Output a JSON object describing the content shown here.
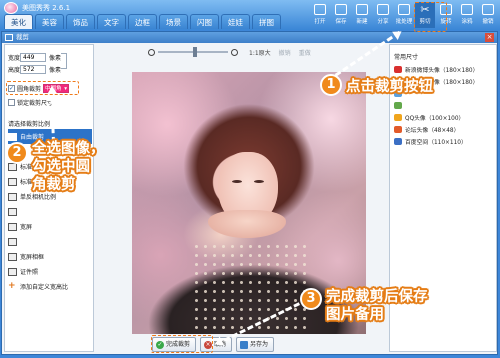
{
  "app": {
    "title": "美图秀秀 2.6.1"
  },
  "window_controls": [
    "_",
    "□",
    "×"
  ],
  "main_tabs": [
    "美化",
    "美容",
    "饰品",
    "文字",
    "边框",
    "场景",
    "闪图",
    "娃娃",
    "拼图"
  ],
  "toolbar": [
    {
      "label": "打开",
      "icon": "open-folder-icon"
    },
    {
      "label": "保存",
      "icon": "save-icon"
    },
    {
      "label": "新建",
      "icon": "new-file-icon"
    },
    {
      "label": "分享",
      "icon": "share-icon"
    },
    {
      "label": "批处理",
      "icon": "batch-icon"
    },
    {
      "label": "剪切",
      "icon": "crop-icon"
    },
    {
      "label": "旋转",
      "icon": "rotate-icon"
    },
    {
      "label": "涂鸦",
      "icon": "doodle-icon"
    },
    {
      "label": "撤销",
      "icon": "undo-icon"
    }
  ],
  "dialog": {
    "title": "裁剪",
    "width_label": "宽度",
    "width_value": "449",
    "height_label": "高度",
    "height_value": "572",
    "unit": "像素",
    "rounded_corner_label": "圆角裁剪",
    "rounded_corner_checked": true,
    "rounded_corner_option": "中圆角",
    "lock_ratio_label": "锁定裁剪尺寸",
    "lock_ratio_checked": false,
    "preset_header": "请选择裁剪比例",
    "presets": [
      {
        "label": "自由裁剪",
        "selected": true
      },
      {
        "label": "",
        "selected": false
      },
      {
        "label": "标准",
        "selected": false
      },
      {
        "label": "标准",
        "selected": false
      },
      {
        "label": "单反相机比例",
        "selected": false
      },
      {
        "label": "",
        "selected": false
      },
      {
        "label": "宽屏",
        "selected": false
      },
      {
        "label": "",
        "selected": false
      },
      {
        "label": "宽屏相框",
        "selected": false
      },
      {
        "label": "证件照",
        "selected": false
      },
      {
        "label": "添加自定义宽高比",
        "selected": false,
        "add": true
      }
    ],
    "zoom": {
      "fit": "1:1原大",
      "undo": "撤销",
      "redo": "重做",
      "level": 0.5
    },
    "common_sizes_header": "常用尺寸",
    "common_sizes": [
      {
        "label": "新浪微博头像（180×180）",
        "color": "#d9302f"
      },
      {
        "label": "腾讯微博头像（180×180）",
        "color": "#3a8ed8"
      },
      {
        "label": "",
        "color": "#5aa0de"
      },
      {
        "label": "",
        "color": "#63a84b"
      },
      {
        "label": "QQ头像（100×100）",
        "color": "#f0a51c"
      },
      {
        "label": "论坛头像（48×48）",
        "color": "#e25b2a"
      },
      {
        "label": "百度空间（110×110）",
        "color": "#3b6fc4"
      }
    ],
    "buttons": {
      "confirm": "完成裁剪",
      "cancel": "取消",
      "save_as": "另存为"
    }
  },
  "callouts": {
    "step1": {
      "number": "1",
      "text": "点击裁剪按钮"
    },
    "step2": {
      "number": "2",
      "lines": [
        "全选图像，",
        "勾选中圆",
        "角裁剪"
      ]
    },
    "step3": {
      "number": "3",
      "lines": [
        "完成裁剪后保存",
        "图片备用"
      ]
    }
  },
  "colors": {
    "accent": "#f08a1c",
    "title_bar": "#3d86d8",
    "selected": "#2c73c8",
    "rounded_option": "#f1297b"
  }
}
